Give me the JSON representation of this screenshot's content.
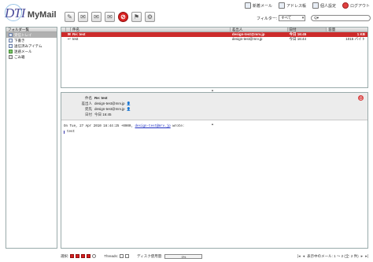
{
  "app": {
    "logo_dti": "DTI",
    "logo_mymail": "MyMail"
  },
  "toplinks": [
    {
      "label": "新着メール",
      "icon": "new-mail-icon"
    },
    {
      "label": "アドレス帳",
      "icon": "address-book-icon"
    },
    {
      "label": "個人設定",
      "icon": "settings-icon"
    },
    {
      "label": "ログアウト",
      "icon": "logout-icon"
    }
  ],
  "toolbar": {
    "buttons": [
      {
        "icon": "compose-icon",
        "glyph": "✎"
      },
      {
        "icon": "reply-icon",
        "glyph": "✉"
      },
      {
        "icon": "reply-all-icon",
        "glyph": "✉"
      },
      {
        "icon": "forward-icon",
        "glyph": "✉"
      },
      {
        "icon": "delete-icon",
        "glyph": "⊘"
      },
      {
        "icon": "mark-icon",
        "glyph": "⚑"
      },
      {
        "icon": "gear-icon",
        "glyph": "⚙"
      }
    ]
  },
  "filter": {
    "label": "フィルター:",
    "value": "すべて",
    "search_placeholder": "Q▾"
  },
  "sidebar": {
    "header": "フォルダ一覧",
    "items": [
      {
        "label": "受信トレイ",
        "active": true,
        "icon": "inbox-icon"
      },
      {
        "label": "下書き",
        "active": false,
        "icon": "drafts-icon"
      },
      {
        "label": "送信済みアイテム",
        "active": false,
        "icon": "sent-icon"
      },
      {
        "label": "迷惑メール",
        "active": false,
        "icon": "junk-icon"
      },
      {
        "label": "ごみ箱",
        "active": false,
        "icon": "trash-icon"
      }
    ]
  },
  "message_list": {
    "columns": [
      "",
      "",
      "件名",
      "差出人",
      "日付",
      "容量"
    ],
    "rows": [
      {
        "icon": "✉",
        "subject": "Re: test",
        "from": "design-test@mrv.jp",
        "date": "今日 16:45",
        "size": "1 KB",
        "selected": true
      },
      {
        "icon": "↩",
        "subject": "test",
        "from": "design-test@mrv.jp",
        "date": "今日 16:44",
        "size": "1015 バイト",
        "selected": false
      }
    ]
  },
  "preview": {
    "labels": {
      "subject": "件名",
      "from": "差出人",
      "to": "宛先",
      "date": "日付"
    },
    "subject": "Re: test",
    "from": "design-test@mrv.jp",
    "to": "design-test@mrv.jp",
    "date": "今日 16:45",
    "body_intro": "On Tue, 27 Apr 2010 16:44:25 +0900,",
    "body_link": "design-test@mrv.jp",
    "body_suffix": "wrote:",
    "body_quote": "test"
  },
  "footer": {
    "select_label": "選択:",
    "threads_label": "Threads:",
    "disk_label": "ディスク使用量:",
    "disk_value": "0%",
    "pager": "表示中のメール: 1 〜 2 (全: 2 件)"
  },
  "colors": {
    "selected_row": "#cc2b2b",
    "accent": "#4a4a9a"
  }
}
